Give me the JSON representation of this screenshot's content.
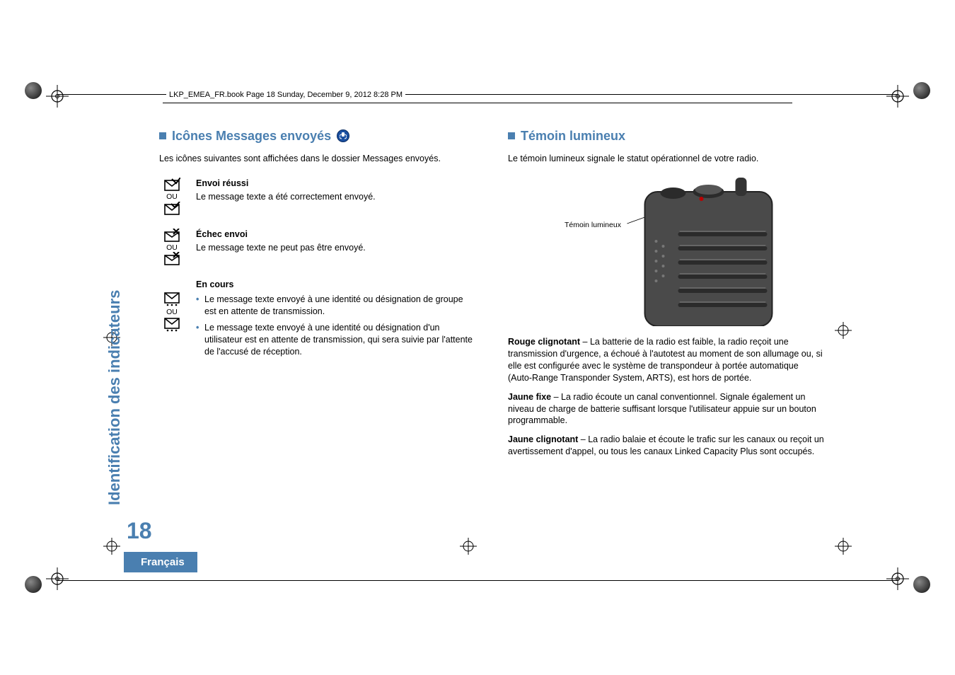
{
  "header": {
    "book_line": "LKP_EMEA_FR.book  Page 18  Sunday, December 9, 2012  8:28 PM"
  },
  "side": {
    "section_title": "Identification des indicateurs",
    "page_number": "18",
    "language": "Français"
  },
  "left": {
    "heading": "Icônes Messages envoyés",
    "intro": "Les icônes suivantes sont affichées dans le dossier Messages envoyés.",
    "ou": "OU",
    "items": [
      {
        "title": "Envoi réussi",
        "text": "Le message texte a été correctement envoyé."
      },
      {
        "title": "Échec envoi",
        "text": "Le message texte ne peut pas être envoyé."
      }
    ],
    "inprog": {
      "title": "En cours",
      "bullets": [
        "Le message texte envoyé à une identité ou désignation de groupe est en attente de transmission.",
        "Le message texte envoyé à une identité ou désignation d'un utilisateur est en attente de transmission, qui sera suivie par l'attente de l'accusé de réception."
      ]
    }
  },
  "right": {
    "heading": "Témoin lumineux",
    "intro": "Le témoin lumineux signale le statut opérationnel de votre radio.",
    "fig_label": "Témoin lumineux",
    "statuses": [
      {
        "name": "Rouge clignotant",
        "text": " – La batterie de la radio est faible, la radio reçoit une transmission d'urgence, a échoué à l'autotest au moment de son allumage ou, si elle est configurée avec le système de transpondeur à portée automatique (Auto-Range Transponder System, ARTS), est hors de portée."
      },
      {
        "name": "Jaune fixe",
        "text": " – La radio écoute un canal conventionnel. Signale également un niveau de charge de batterie suffisant lorsque l'utilisateur appuie sur un bouton programmable."
      },
      {
        "name": "Jaune clignotant",
        "text": " – La radio balaie et écoute le trafic sur les canaux ou reçoit un avertissement d'appel, ou tous les canaux Linked Capacity Plus sont occupés."
      }
    ]
  }
}
